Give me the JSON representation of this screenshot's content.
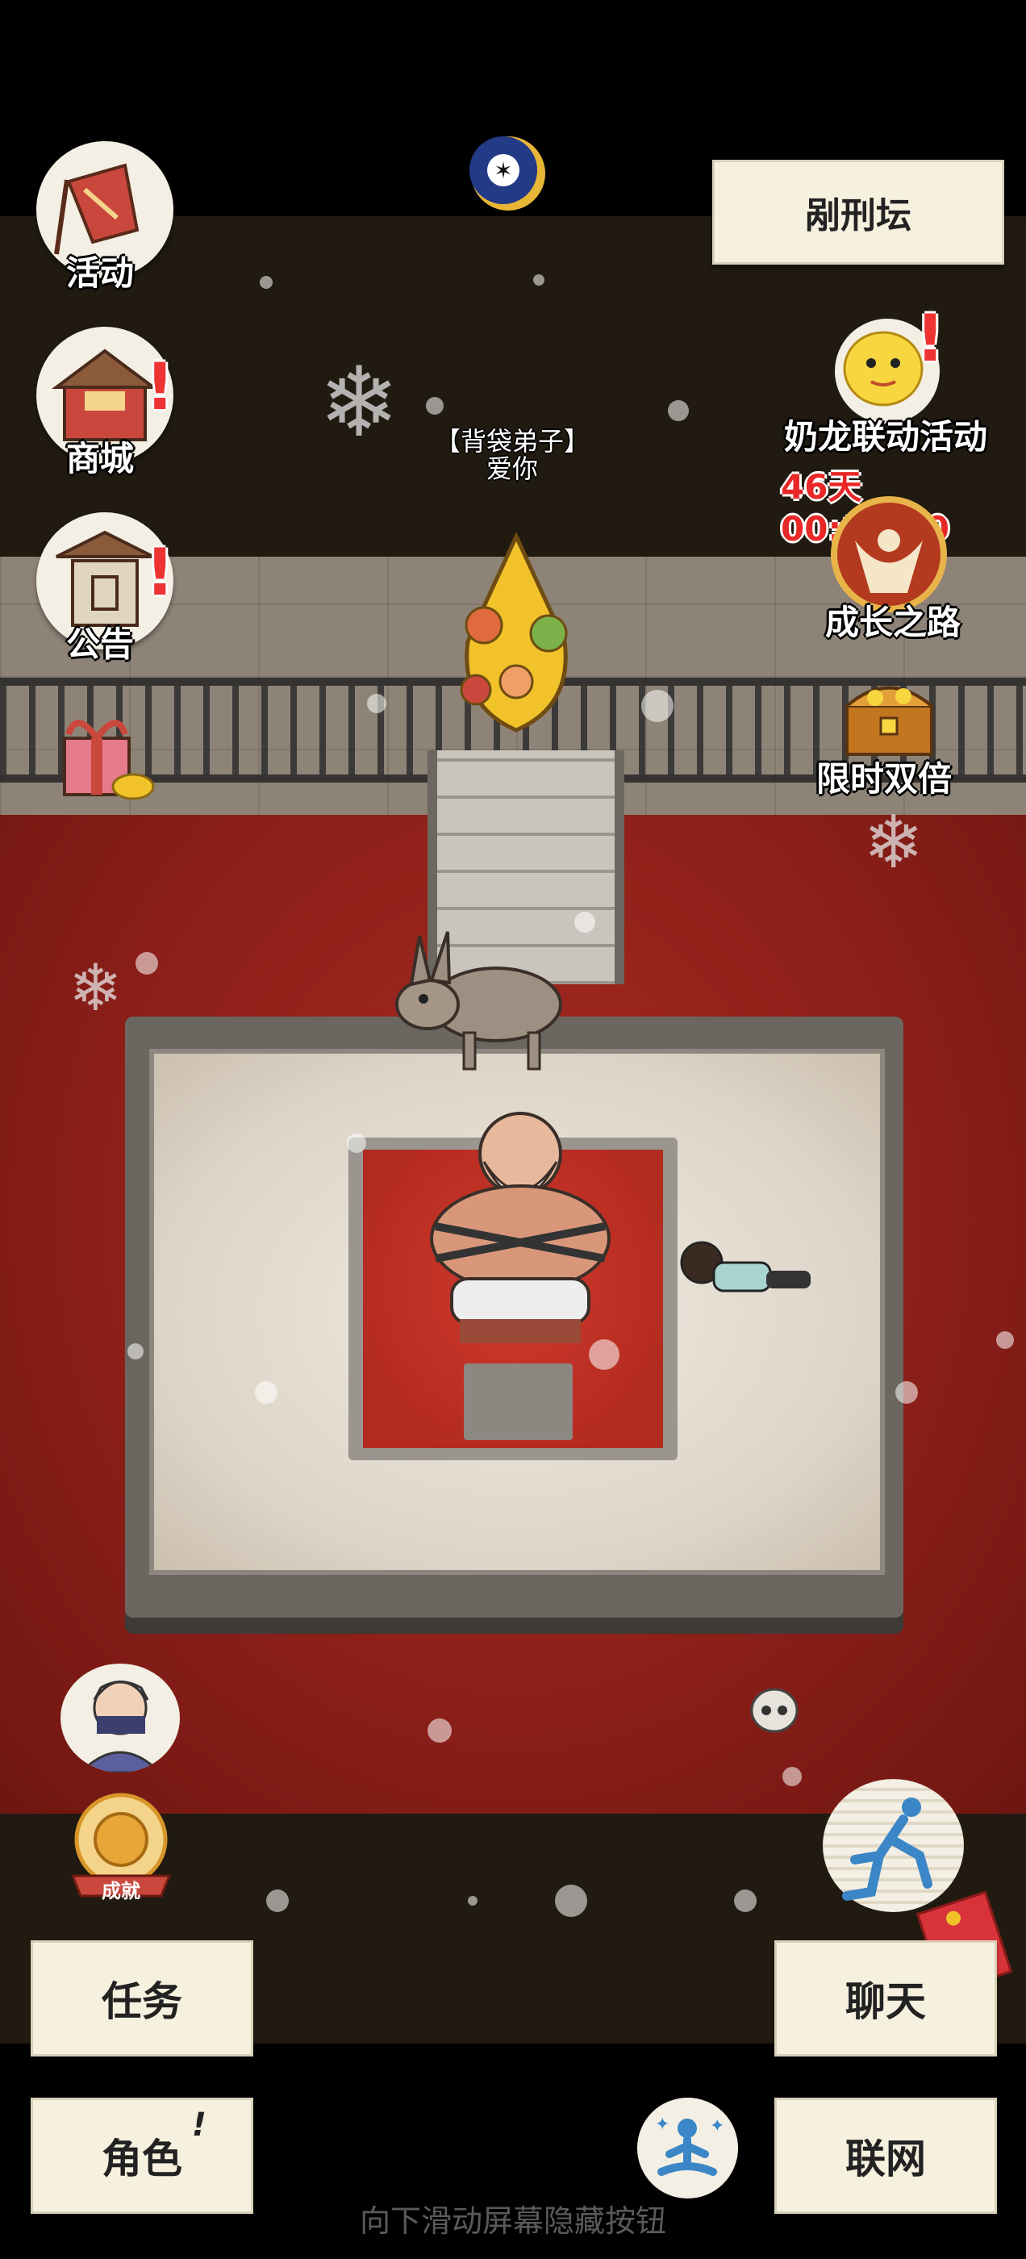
{
  "location": {
    "name": "剐刑坛"
  },
  "npc_label": {
    "line1": "【背袋弟子】",
    "line2": "爱你"
  },
  "left_menu": [
    {
      "label": "活动",
      "icon": "banner-icon"
    },
    {
      "label": "商城",
      "icon": "shop-icon"
    },
    {
      "label": "公告",
      "icon": "notice-board-icon"
    },
    {
      "label": "",
      "icon": "gift-icon"
    }
  ],
  "right_menu": {
    "event": {
      "label": "奶龙联动活动",
      "timer": "46天00:17:00"
    },
    "growth": {
      "label": "成长之路"
    },
    "double": {
      "label": "限时双倍"
    }
  },
  "bottom_left": {
    "achievement_label": "成就"
  },
  "buttons": {
    "task": "任务",
    "character": "角色",
    "chat": "聊天",
    "network": "联网"
  },
  "hint": "向下滑动屏幕隐藏按钮",
  "badge_mark": "!"
}
